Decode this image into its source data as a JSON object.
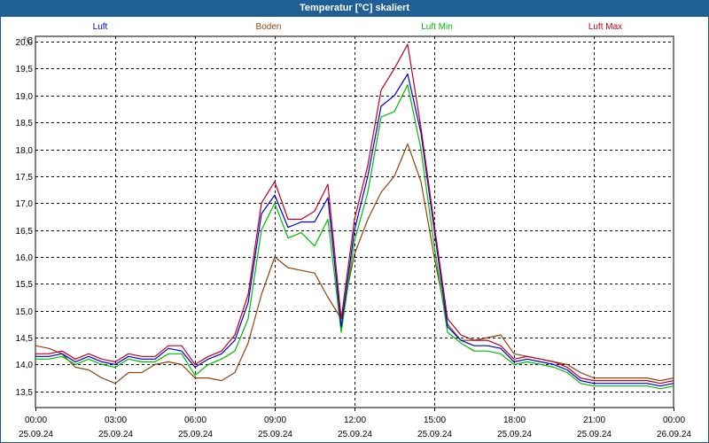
{
  "window": {
    "title": "Temperatur [°C] skaliert"
  },
  "colors": {
    "title_bar": "#1f5f95",
    "grid": "#000000",
    "luft": "#0000cc",
    "boden": "#8b4513",
    "luft_min": "#00bb00",
    "luft_max": "#bb0022"
  },
  "chart_data": {
    "type": "line",
    "title": "Temperatur [°C] skaliert",
    "ylabel": "°C",
    "xlabel": "",
    "ylim": [
      13.2,
      20.1
    ],
    "xlim": [
      0,
      24
    ],
    "grid": true,
    "legend_position": "top",
    "y_ticks": [
      "20,0",
      "19,5",
      "19,0",
      "18,5",
      "18,0",
      "17,5",
      "17,0",
      "16,5",
      "16,0",
      "15,5",
      "15,0",
      "14,5",
      "14,0",
      "13,5"
    ],
    "y_tick_values": [
      20.0,
      19.5,
      19.0,
      18.5,
      18.0,
      17.5,
      17.0,
      16.5,
      16.0,
      15.5,
      15.0,
      14.5,
      14.0,
      13.5
    ],
    "x_ticks": [
      {
        "time": "00:00",
        "date": "25.09.24"
      },
      {
        "time": "03:00",
        "date": "25.09.24"
      },
      {
        "time": "06:00",
        "date": "25.09.24"
      },
      {
        "time": "09:00",
        "date": "25.09.24"
      },
      {
        "time": "12:00",
        "date": "25.09.24"
      },
      {
        "time": "15:00",
        "date": "25.09.24"
      },
      {
        "time": "18:00",
        "date": "25.09.24"
      },
      {
        "time": "21:00",
        "date": "25.09.24"
      },
      {
        "time": "00:00",
        "date": "26.09.24"
      }
    ],
    "x_tick_hours": [
      0,
      3,
      6,
      9,
      12,
      15,
      18,
      21,
      24
    ],
    "x": [
      0,
      0.5,
      1,
      1.5,
      2,
      2.5,
      3,
      3.5,
      4,
      4.5,
      5,
      5.5,
      6,
      6.5,
      7,
      7.5,
      8,
      8.5,
      9,
      9.5,
      10,
      10.5,
      11,
      11.5,
      12,
      12.5,
      13,
      13.5,
      14,
      14.5,
      15,
      15.5,
      16,
      16.5,
      17,
      17.5,
      18,
      18.5,
      19,
      19.5,
      20,
      20.5,
      21,
      21.5,
      22,
      22.5,
      23,
      23.5,
      24
    ],
    "series": [
      {
        "name": "Luft",
        "color": "#0000cc",
        "values": [
          14.15,
          14.15,
          14.2,
          14.05,
          14.15,
          14.05,
          14.0,
          14.15,
          14.1,
          14.1,
          14.3,
          14.25,
          13.95,
          14.1,
          14.2,
          14.45,
          15.15,
          16.8,
          17.15,
          16.55,
          16.65,
          16.65,
          17.1,
          14.7,
          16.5,
          17.5,
          18.8,
          19.0,
          19.4,
          18.3,
          16.5,
          14.7,
          14.45,
          14.35,
          14.35,
          14.3,
          14.05,
          14.1,
          14.05,
          14.0,
          13.9,
          13.7,
          13.65,
          13.65,
          13.65,
          13.65,
          13.65,
          13.6,
          13.65
        ]
      },
      {
        "name": "Boden",
        "color": "#8b4513",
        "values": [
          14.35,
          14.3,
          14.2,
          13.95,
          13.9,
          13.75,
          13.65,
          13.85,
          13.85,
          14.0,
          14.05,
          14.0,
          13.75,
          13.75,
          13.7,
          13.85,
          14.4,
          15.3,
          16.0,
          15.8,
          15.75,
          15.7,
          15.25,
          14.85,
          16.05,
          16.7,
          17.2,
          17.5,
          18.1,
          17.4,
          16.0,
          14.75,
          14.45,
          14.45,
          14.5,
          14.55,
          14.2,
          14.15,
          14.1,
          14.05,
          14.0,
          13.85,
          13.75,
          13.75,
          13.75,
          13.75,
          13.75,
          13.7,
          13.75
        ]
      },
      {
        "name": "Luft Min",
        "color": "#00bb00",
        "values": [
          14.1,
          14.1,
          14.15,
          14.0,
          14.1,
          14.0,
          13.95,
          14.1,
          14.05,
          14.05,
          14.2,
          14.2,
          13.8,
          14.0,
          14.1,
          14.25,
          14.85,
          16.5,
          17.0,
          16.35,
          16.45,
          16.2,
          16.7,
          14.6,
          16.3,
          17.2,
          18.6,
          18.7,
          19.2,
          18.0,
          16.2,
          14.6,
          14.4,
          14.25,
          14.25,
          14.2,
          14.0,
          14.05,
          14.0,
          13.95,
          13.85,
          13.65,
          13.6,
          13.6,
          13.6,
          13.6,
          13.6,
          13.55,
          13.6
        ]
      },
      {
        "name": "Luft Max",
        "color": "#bb0022",
        "values": [
          14.2,
          14.2,
          14.25,
          14.1,
          14.2,
          14.1,
          14.05,
          14.2,
          14.15,
          14.15,
          14.35,
          14.35,
          14.0,
          14.15,
          14.25,
          14.55,
          15.3,
          17.0,
          17.4,
          16.7,
          16.7,
          16.85,
          17.35,
          14.85,
          16.7,
          17.7,
          19.1,
          19.5,
          19.95,
          18.4,
          16.6,
          14.85,
          14.55,
          14.45,
          14.45,
          14.35,
          14.1,
          14.15,
          14.1,
          14.05,
          13.95,
          13.75,
          13.7,
          13.7,
          13.7,
          13.7,
          13.7,
          13.65,
          13.7
        ]
      }
    ]
  }
}
